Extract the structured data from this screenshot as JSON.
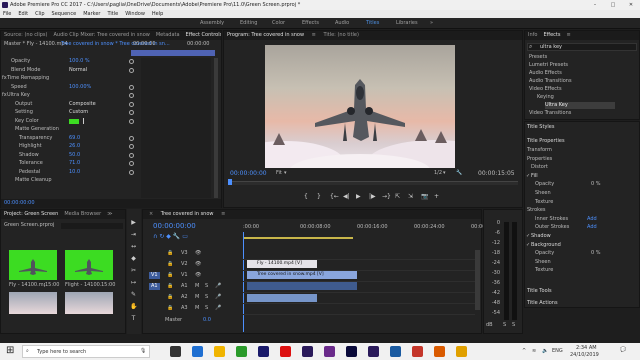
{
  "window": {
    "title": "Adobe Premiere Pro CC 2017 - C:\\Users\\paglia\\OneDrive\\Documents\\Adobe\\Premiere Pro\\11.0\\Green Screen.prproj *",
    "minimize": "–",
    "maximize": "□",
    "close": "✕"
  },
  "menu": [
    "File",
    "Edit",
    "Clip",
    "Sequence",
    "Marker",
    "Title",
    "Window",
    "Help"
  ],
  "workspaces": {
    "items": [
      "Assembly",
      "Editing",
      "Color",
      "Effects",
      "Audio",
      "Titles",
      "Libraries"
    ],
    "active": "Titles",
    "overflow": "»"
  },
  "source_tabs": [
    "Source: (no clips)",
    "Audio Clip Mixer: Tree covered in snow",
    "Metadata",
    "Effect Controls",
    "≡"
  ],
  "effect_controls": {
    "master": "Master * Fly - 14100.mp4",
    "clip": "Tree covered in snow * Tree covered in sn...",
    "timecode_top": "00:00:00",
    "timecode_right": "00:00:00",
    "rows": [
      {
        "label": "Opacity",
        "value": "100.0 %",
        "blue": true
      },
      {
        "label": "Blend Mode",
        "value": "Normal"
      },
      {
        "label": "Time Remapping",
        "value": ""
      },
      {
        "label": "Speed",
        "value": "100.00%",
        "blue": true
      },
      {
        "label": "Ultra Key",
        "value": ""
      },
      {
        "label": "Output",
        "value": "Composite"
      },
      {
        "label": "Setting",
        "value": "Custom"
      },
      {
        "label": "Key Color",
        "value": ""
      },
      {
        "label": "Matte Generation",
        "value": ""
      },
      {
        "label": "Transparency",
        "value": "69.0",
        "blue": true
      },
      {
        "label": "Highlight",
        "value": "26.0",
        "blue": true
      },
      {
        "label": "Shadow",
        "value": "50.0",
        "blue": true
      },
      {
        "label": "Tolerance",
        "value": "71.0",
        "blue": true
      },
      {
        "label": "Pedestal",
        "value": "10.0",
        "blue": true
      },
      {
        "label": "Matte Cleanup",
        "value": ""
      }
    ],
    "fx": "fx",
    "bottom_timecode": "00:00:00:00",
    "key_color": "#3cdc22"
  },
  "program": {
    "title": "Program: Tree covered in snow",
    "title_menu": "≡",
    "title2": "Title: (no title)",
    "timecode": "00:00:00:00",
    "fit": "Fit",
    "fit_arrow": "▾",
    "ratio": "1/2",
    "ratio_arrow": "▾",
    "duration": "00:00:15:05",
    "wrench": "🔧"
  },
  "transport": {
    "mark_in": "{",
    "mark_out": "}",
    "go_in": "{←",
    "step_back": "◀|",
    "play": "▶",
    "step_fwd": "|▶",
    "go_out": "→}",
    "lift": "⇱",
    "extract": "⇲",
    "export_frame": "📷",
    "add": "+"
  },
  "info_tabs": [
    "Info",
    "Effects",
    "≡"
  ],
  "effects_panel": {
    "search": "ultra key",
    "search_icon": "⌕",
    "tree": [
      {
        "label": "Presets",
        "indent": 0
      },
      {
        "label": "Lumetri Presets",
        "indent": 0
      },
      {
        "label": "Audio Effects",
        "indent": 0
      },
      {
        "label": "Audio Transitions",
        "indent": 0
      },
      {
        "label": "Video Effects",
        "indent": 0
      },
      {
        "label": "Keying",
        "indent": 1
      },
      {
        "label": "Ultra Key",
        "indent": 2
      },
      {
        "label": "Video Transitions",
        "indent": 0
      }
    ]
  },
  "title_panel": {
    "title_styles": "Title Styles",
    "properties": "Title Properties",
    "sections": [
      "Transform",
      "Properties",
      "Distort",
      "Fill",
      "Opacity",
      "Sheen",
      "Texture"
    ],
    "fill_check": "✓",
    "strokes": "Strokes",
    "inner": "Inner Strokes",
    "outer": "Outer Strokes",
    "add": "Add",
    "shadow": "Shadow",
    "background": "Background",
    "title_tools": "Title Tools",
    "title_actions": "Title Actions",
    "pct": "0 %"
  },
  "project": {
    "tabs": [
      "Project: Green Screen",
      "Media Browser",
      "≫"
    ],
    "file": "Green Screen.prproj",
    "items": [
      {
        "name": "Fly - 14100.mp4",
        "dur": "15:00"
      },
      {
        "name": "Flight - 14100.mp4",
        "dur": "15:00"
      }
    ]
  },
  "timeline": {
    "tab": "Tree covered in snow",
    "menu": "≡",
    "close": "×",
    "timecode": "00:00:00:00",
    "ruler": [
      ":00:00",
      "00:00:08:00",
      "00:00:16:00",
      "00:00:24:00",
      "00:00:"
    ],
    "tracks": [
      {
        "name": "V3"
      },
      {
        "name": "V2"
      },
      {
        "name": "V1"
      },
      {
        "name": "A1"
      },
      {
        "name": "A2"
      },
      {
        "name": "A3"
      }
    ],
    "source_v": "V1",
    "source_a": "A1",
    "master": "Master",
    "master_val": "0.0",
    "clip_top": "Fly - 14100.mp4 [V]",
    "clip_main": "Tree covered in snow.mp4 [V]",
    "fx": "fx",
    "toggles": [
      "🔒",
      "👁",
      "M",
      "S",
      "🎤"
    ]
  },
  "tools": [
    "▶",
    "⇥",
    "↔",
    "◆",
    "✂",
    "↦",
    "✎",
    "✋",
    "T"
  ],
  "meter": {
    "scale": [
      "0",
      "-6",
      "-12",
      "-18",
      "-24",
      "-30",
      "-36",
      "-42",
      "-48",
      "-54"
    ],
    "db": "dB",
    "solo_l": "S",
    "solo_r": "S"
  },
  "taskbar": {
    "search": "Type here to search",
    "time": "2:34 AM",
    "date": "24/10/2019",
    "start": "⊞",
    "mic": "🎙",
    "eng": "ENG",
    "up": "^",
    "net": "≋",
    "vol": "🔈",
    "notify": "💬"
  }
}
